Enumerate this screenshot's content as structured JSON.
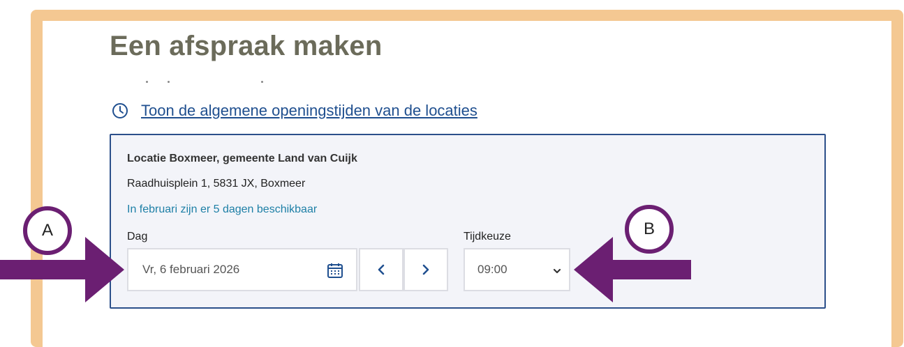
{
  "page": {
    "title": "Een afspraak maken",
    "hours_link": "Toon de algemene openingstijden van de locaties"
  },
  "location": {
    "name": "Locatie Boxmeer, gemeente Land van Cuijk",
    "address": "Raadhuisplein 1, 5831 JX, Boxmeer",
    "availability": "In februari zijn er 5 dagen beschikbaar"
  },
  "form": {
    "day_label": "Dag",
    "day_value": "Vr, 6 februari 2026",
    "prev_label": "‹",
    "next_label": "›",
    "time_label": "Tijdkeuze",
    "time_value": "09:00"
  },
  "annotations": {
    "marker_a": "A",
    "marker_b": "B",
    "frame_color": "#f4c892",
    "arrow_color": "#6b1f72"
  },
  "icons": [
    "clock-icon",
    "calendar-icon",
    "chevron-down-icon",
    "chevron-left-icon",
    "chevron-right-icon"
  ]
}
